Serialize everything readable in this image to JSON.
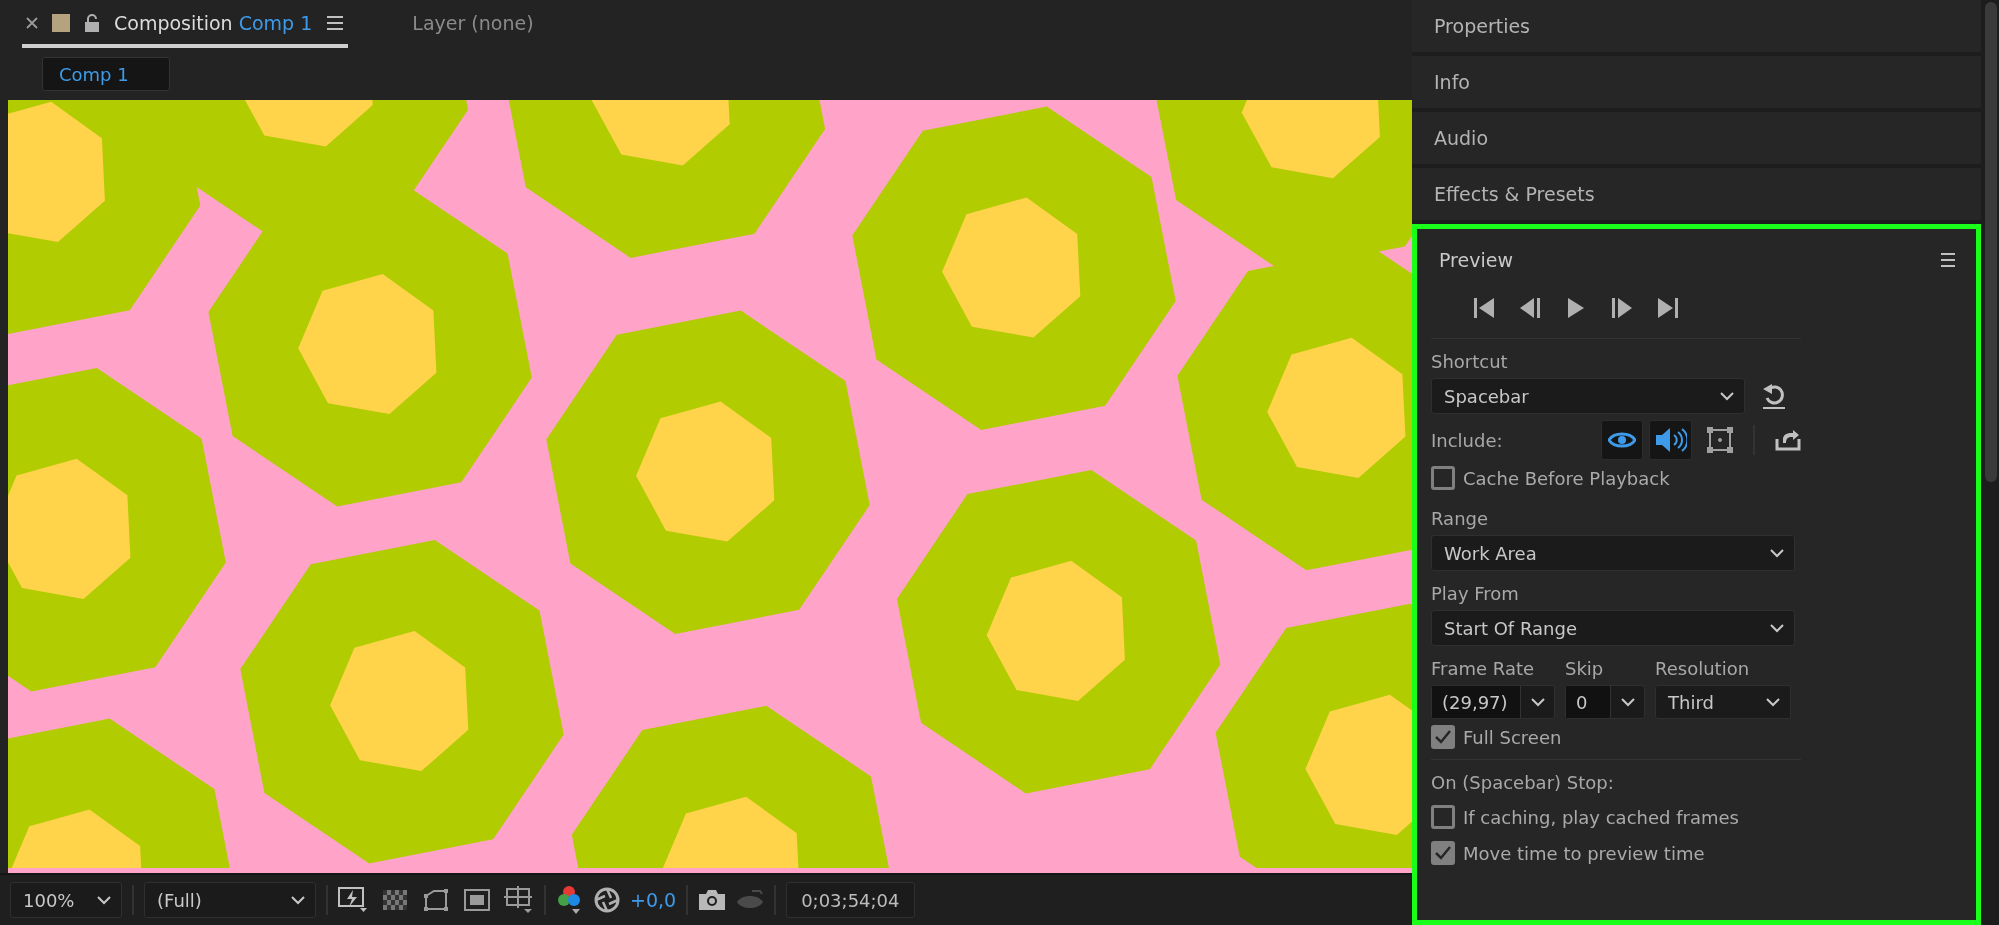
{
  "composition_panel": {
    "tabs": [
      {
        "kind": "composition",
        "label": "Composition",
        "comp_name": "Comp 1",
        "selected": true
      },
      {
        "kind": "layer",
        "label": "Layer (none)",
        "selected": false
      }
    ],
    "breadcrumb": "Comp 1"
  },
  "viewer_toolbar": {
    "zoom": "100%",
    "resolution": "(Full)",
    "exposure": "+0,0",
    "timecode": "0;03;54;04"
  },
  "side_panels": [
    {
      "title": "Properties"
    },
    {
      "title": "Info"
    },
    {
      "title": "Audio"
    },
    {
      "title": "Effects & Presets"
    }
  ],
  "preview": {
    "title": "Preview",
    "shortcut_label": "Shortcut",
    "shortcut": "Spacebar",
    "include_label": "Include:",
    "include": [
      {
        "kind": "video",
        "on": true
      },
      {
        "kind": "audio",
        "on": true
      },
      {
        "kind": "overlays",
        "on": false
      }
    ],
    "cache_before_playback": {
      "label": "Cache Before Playback",
      "checked": false
    },
    "range_label": "Range",
    "range": "Work Area",
    "play_from_label": "Play From",
    "play_from": "Start Of Range",
    "frame_rate_label": "Frame Rate",
    "frame_rate": "(29,97)",
    "skip_label": "Skip",
    "skip": "0",
    "resolution_label": "Resolution",
    "resolution": "Third",
    "full_screen": {
      "label": "Full Screen",
      "checked": true
    },
    "stop_label": "On (Spacebar) Stop:",
    "stop_options": [
      {
        "label": "If caching, play cached frames",
        "checked": false
      },
      {
        "label": "Move time to preview time",
        "checked": true
      }
    ]
  }
}
